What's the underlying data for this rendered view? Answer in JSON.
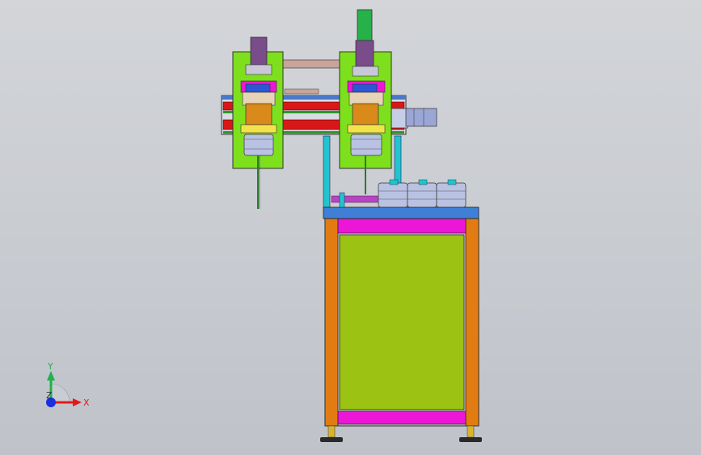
{
  "viewport": {
    "background_top": "#d3d5d9",
    "background_bottom": "#bfc3c9"
  },
  "model": {
    "colors": {
      "plate_green": "#7ee01d",
      "frame_orange": "#e27c12",
      "panel_olive": "#9cc214",
      "band_magenta": "#ec16d6",
      "rail_red": "#d81818",
      "rail_beam": "#c9a49a",
      "cyan_post": "#21c4cf",
      "blue_table": "#3f7fd6",
      "gold_part": "#d98a1b",
      "cylinder_purple": "#7a4c8a",
      "cylinder_green": "#27b14a",
      "silver_motor": "#b9c2e2"
    }
  },
  "triad": {
    "y_label": "Y",
    "x_label": "X",
    "z_label": "Z",
    "x_color": "#e21a1a",
    "y_color": "#22b14c",
    "z_color": "#1a2ee2"
  }
}
